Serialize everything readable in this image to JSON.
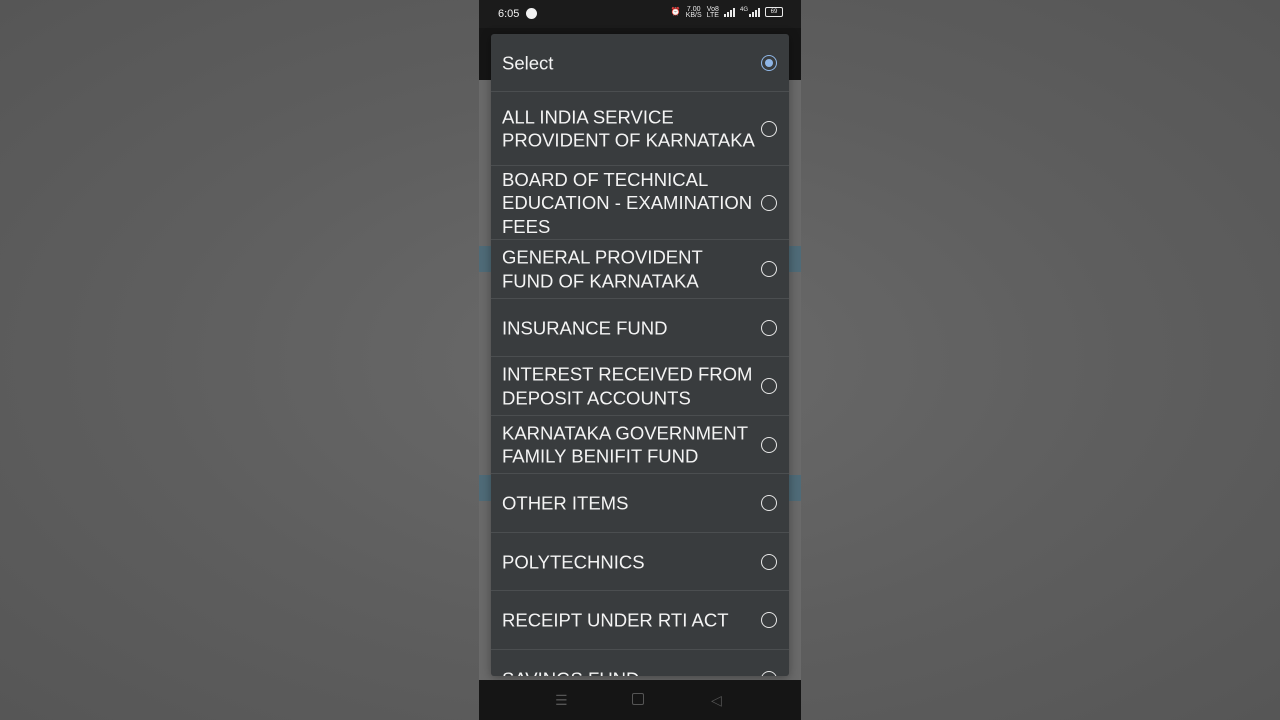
{
  "status_bar": {
    "time": "6:05",
    "net_speed": "7.00",
    "net_speed_unit": "KB/S",
    "network_label": "Vo8",
    "network_label2": "LTE",
    "signal2_label": "4G",
    "battery": "69"
  },
  "dialog": {
    "options": [
      {
        "label": "Select",
        "selected": true
      },
      {
        "label": "ALL INDIA SERVICE PROVIDENT OF KARNATAKA",
        "selected": false
      },
      {
        "label": "BOARD OF TECHNICAL EDUCATION - EXAMINATION FEES",
        "selected": false
      },
      {
        "label": "GENERAL PROVIDENT FUND OF KARNATAKA",
        "selected": false
      },
      {
        "label": "INSURANCE FUND",
        "selected": false
      },
      {
        "label": "INTEREST RECEIVED FROM DEPOSIT ACCOUNTS",
        "selected": false
      },
      {
        "label": "KARNATAKA GOVERNMENT FAMILY BENIFIT FUND",
        "selected": false
      },
      {
        "label": "OTHER ITEMS",
        "selected": false
      },
      {
        "label": "POLYTECHNICS",
        "selected": false
      },
      {
        "label": "RECEIPT UNDER RTI ACT",
        "selected": false
      },
      {
        "label": "SAVINGS FUND",
        "selected": false
      }
    ]
  },
  "colors": {
    "dialog_bg": "#393c3e",
    "divider": "#4b4e50",
    "radio_selected": "#8fb6e6",
    "band": "#4f6b78"
  }
}
